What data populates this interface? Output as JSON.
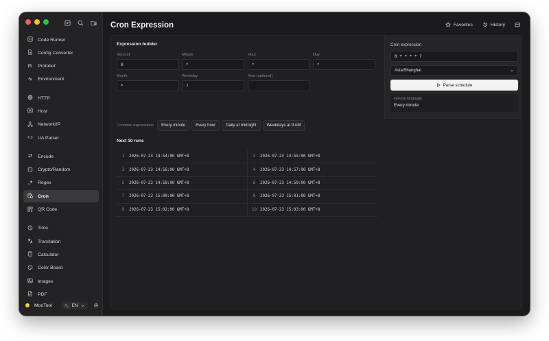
{
  "app": {
    "name": "MooTool",
    "language": "EN"
  },
  "page": {
    "title": "Cron Expression"
  },
  "header": {
    "favorites_label": "Favorites",
    "history_label": "History"
  },
  "sidebar": {
    "groups": [
      [
        {
          "label": "Code Runner",
          "icon": "code-icon"
        },
        {
          "label": "Config Converter",
          "icon": "convert-icon"
        },
        {
          "label": "Protobuf",
          "icon": "protobuf-icon"
        },
        {
          "label": "Environment",
          "icon": "environment-icon"
        }
      ],
      [
        {
          "label": "HTTP",
          "icon": "globe-icon"
        },
        {
          "label": "Host",
          "icon": "host-icon"
        },
        {
          "label": "Network/IP",
          "icon": "network-icon"
        },
        {
          "label": "UA Parser",
          "icon": "code-brackets-icon"
        }
      ],
      [
        {
          "label": "Encode",
          "icon": "swap-icon"
        },
        {
          "label": "Crypto/Random",
          "icon": "dice-icon"
        },
        {
          "label": "Regex",
          "icon": "regex-icon"
        },
        {
          "label": "Cron",
          "icon": "calendar-clock-icon",
          "active": true
        },
        {
          "label": "QR Code",
          "icon": "qr-icon"
        }
      ],
      [
        {
          "label": "Time",
          "icon": "clock-icon"
        },
        {
          "label": "Translation",
          "icon": "translate-icon"
        },
        {
          "label": "Calculator",
          "icon": "calculator-icon"
        },
        {
          "label": "Color Board",
          "icon": "palette-icon"
        },
        {
          "label": "Images",
          "icon": "image-icon"
        },
        {
          "label": "PDF",
          "icon": "pdf-icon"
        }
      ]
    ]
  },
  "builder": {
    "title": "Expression builder",
    "fields": {
      "second": {
        "label": "Second",
        "value": "0"
      },
      "minute": {
        "label": "Minute",
        "value": "*"
      },
      "hour": {
        "label": "Hour",
        "value": "*"
      },
      "day": {
        "label": "Day",
        "value": "*"
      },
      "month": {
        "label": "Month",
        "value": "*"
      },
      "weekday": {
        "label": "Weekday",
        "value": "?"
      },
      "year": {
        "label": "Year (optional)",
        "value": ""
      }
    },
    "common_label": "Common expressions",
    "common": [
      "Every minute",
      "Every hour",
      "Daily at midnight",
      "Weekdays at 9 AM"
    ]
  },
  "runs": {
    "title": "Next 10 runs",
    "items": [
      {
        "n": "1",
        "t": "2026-07-23 14:54:00 GMT+8"
      },
      {
        "n": "2",
        "t": "2026-07-23 14:55:00 GMT+8"
      },
      {
        "n": "3",
        "t": "2026-07-23 14:56:00 GMT+8"
      },
      {
        "n": "4",
        "t": "2026-07-23 14:57:00 GMT+8"
      },
      {
        "n": "5",
        "t": "2026-07-23 14:58:00 GMT+8"
      },
      {
        "n": "6",
        "t": "2026-07-23 14:59:00 GMT+8"
      },
      {
        "n": "7",
        "t": "2026-07-23 15:00:00 GMT+8"
      },
      {
        "n": "8",
        "t": "2026-07-23 15:01:00 GMT+8"
      },
      {
        "n": "9",
        "t": "2026-07-23 15:02:00 GMT+8"
      },
      {
        "n": "10",
        "t": "2026-07-23 15:03:00 GMT+8"
      }
    ]
  },
  "panel": {
    "title": "Cron expression",
    "expression": "0 * * * * ?",
    "timezone": "Asia/Shanghai",
    "parse_label": "Parse schedule",
    "natural_label": "Natural language",
    "natural_value": "Every minute"
  }
}
